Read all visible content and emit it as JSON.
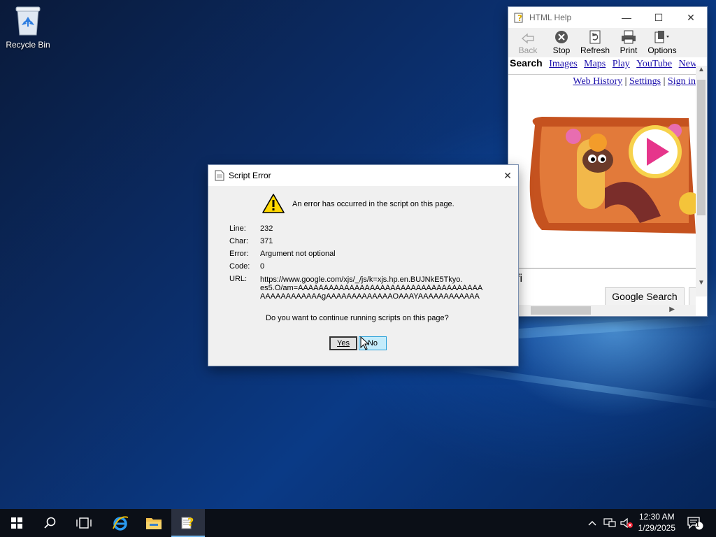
{
  "desktop": {
    "recycle_bin_label": "Recycle Bin"
  },
  "help_window": {
    "title": "HTML Help",
    "toolbar": {
      "back": "Back",
      "stop": "Stop",
      "refresh": "Refresh",
      "print": "Print",
      "options": "Options"
    },
    "nav_links": [
      "Search",
      "Images",
      "Maps",
      "Play",
      "YouTube",
      "New"
    ],
    "secondary_links": [
      "Web History",
      "Settings",
      "Sign in"
    ],
    "search_fragment": "fi",
    "google_search_button": "Google Search"
  },
  "error_dialog": {
    "title": "Script Error",
    "message": "An error has occurred in the script on this page.",
    "fields": [
      {
        "label": "Line:",
        "value": "232"
      },
      {
        "label": "Char:",
        "value": "371"
      },
      {
        "label": "Error:",
        "value": "Argument not optional"
      },
      {
        "label": "Code:",
        "value": "0"
      }
    ],
    "url_label": "URL:",
    "url_lines": [
      "https://www.google.com/xjs/_/js/k=xjs.hp.en.BUJNkE5Tkyo.",
      "es5.O/am=AAAAAAAAAAAAAAAAAAAAAAAAAAAAAAAAAAAA",
      "AAAAAAAAAAAAgAAAAAAAAAAAAAOAAAYAAAAAAAAAAAA"
    ],
    "question": "Do you want to continue running scripts on this page?",
    "yes_label": "Yes",
    "no_label": "No"
  },
  "taskbar": {
    "time": "12:30 AM",
    "date": "1/29/2025",
    "notification_count": "1"
  },
  "colors": {
    "link": "#1a0dab",
    "taskbar": "#0b0f17",
    "no_button_hover": "#c4ecfb"
  }
}
